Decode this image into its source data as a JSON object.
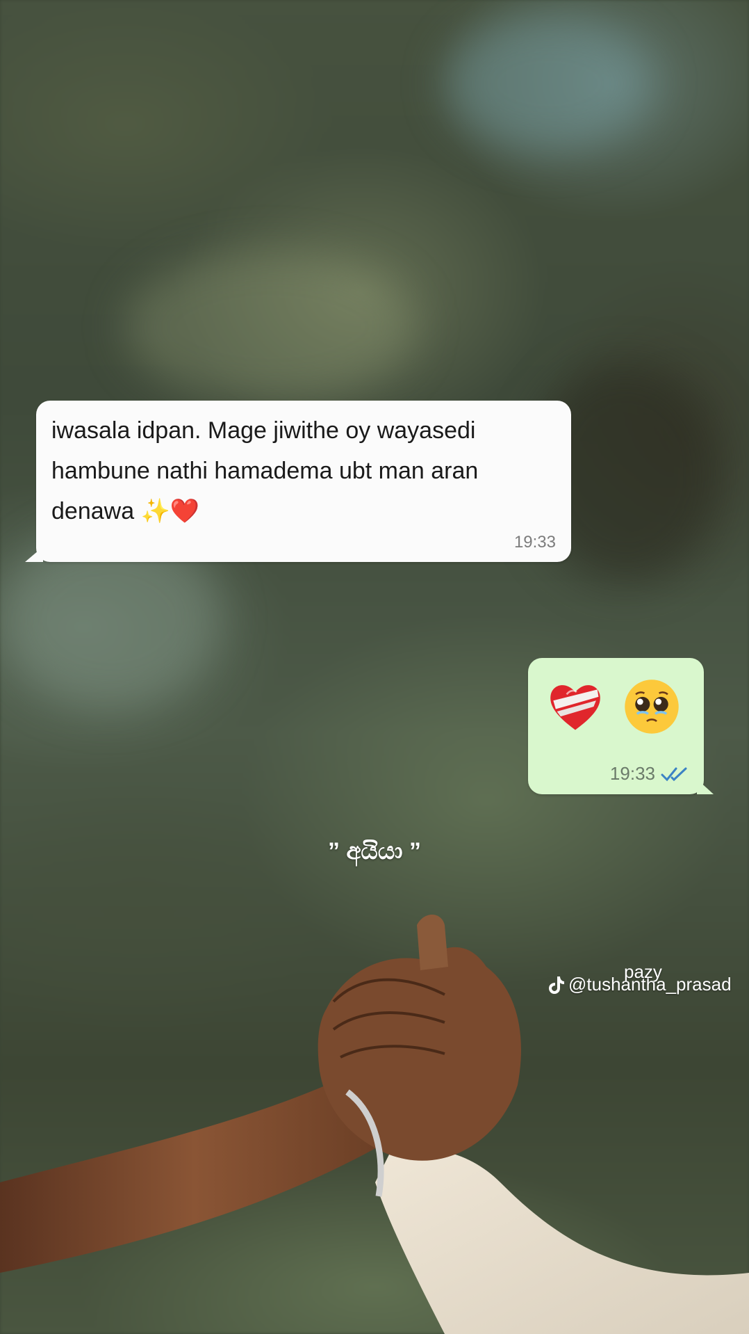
{
  "incoming_message": {
    "text": "iwasala idpan. Mage jiwithe oy wayasedi hambune nathi hamadema ubt man aran denawa ✨❤️",
    "time": "19:33"
  },
  "outgoing_message": {
    "emojis": [
      "mending-heart-icon",
      "pleading-face-icon"
    ],
    "time": "19:33",
    "status_icon": "double-check-read-icon",
    "status_color": "#3b82c4"
  },
  "caption": "” අයියා ”",
  "watermark": {
    "handle": "@tushantha_prasad",
    "overlay_name": "pazy",
    "logo": "tiktok-icon"
  },
  "colors": {
    "incoming_bubble": "#fbfbfb",
    "outgoing_bubble": "#d9f7cd"
  }
}
